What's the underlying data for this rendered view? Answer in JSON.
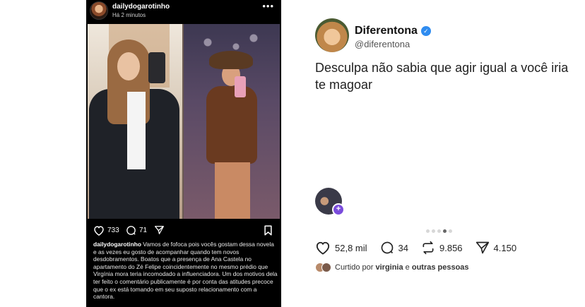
{
  "left_post": {
    "username": "dailydogarotinho",
    "time": "Há 2 minutos",
    "more": "•••",
    "likes": "733",
    "comments": "71",
    "caption_username": "dailydogarotinho",
    "caption_text": "Vamos de fofoca pois vocês gostam dessa novela e as vezes eu gosto de acompanhar quando tem novos desdobramentos. Boatos que a presença de Ana Castela no apartamento do Zé Felipe coincidentemente no mesmo prédio que Virgínia mora teria incomodado a influenciadora. Um dos motivos dela ter feito o comentário publicamente é por conta das atitudes precoce que o ex está tomando em seu suposto relacionamento com a cantora."
  },
  "right_post": {
    "display_name": "Diferentona",
    "handle": "@diferentona",
    "text": "Desculpa não sabia que agir igual a você iria te magoar",
    "reply_plus": "+",
    "likes": "52,8 mil",
    "comments": "34",
    "reposts": "9.856",
    "shares": "4.150",
    "liked_prefix": "Curtido por ",
    "liked_user": "virginia",
    "liked_middle": " e ",
    "liked_suffix": "outras pessoas"
  },
  "colors": {
    "left_bg": "#000000",
    "verified": "#2f8cf0",
    "reply_badge": "#7a4cdc"
  },
  "icons": [
    "heart-icon",
    "comment-icon",
    "send-icon",
    "bookmark-icon",
    "more-icon",
    "verified-badge-icon",
    "repost-icon",
    "share-icon"
  ]
}
